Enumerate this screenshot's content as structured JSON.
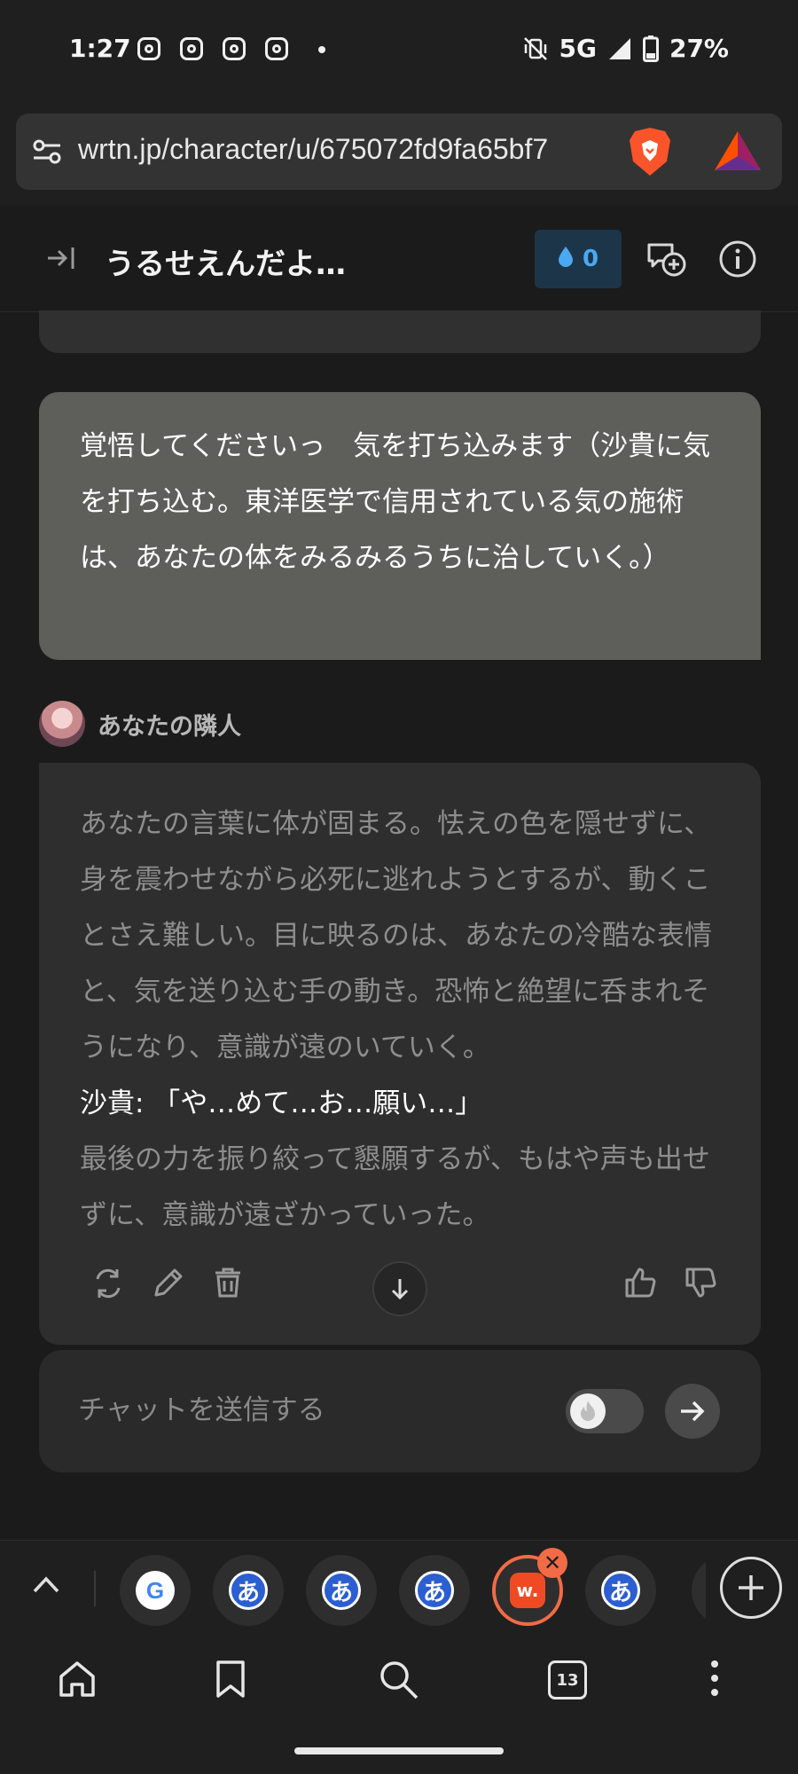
{
  "status_bar": {
    "time": "1:27",
    "notification_icons": [
      "instagram-icon",
      "instagram-icon",
      "instagram-icon",
      "instagram-icon"
    ],
    "network": "5G",
    "battery": "27%"
  },
  "browser": {
    "url": "wrtn.jp/character/u/675072fd9fa65bf7",
    "extension_icons": [
      "brave-shield-icon",
      "brave-rewards-icon"
    ]
  },
  "header": {
    "title": "うるせえんだよ…",
    "drops_count": "0"
  },
  "messages": {
    "user": "覚悟してくださいっ　気を打ち込みます（沙貴に気を打ち込む。東洋医学で信用されている気の施術は、あなたの体をみるみるうちに治していく。）",
    "bot_name": "あなたの隣人",
    "bot_narration_1": "あなたの言葉に体が固まる。怯えの色を隠せずに、身を震わせながら必死に逃れようとするが、動くことさえ難しい。目に映るのは、あなたの冷酷な表情と、気を送り込む手の動き。恐怖と絶望に呑まれそうになり、意識が遠のいていく。",
    "bot_dialogue": "沙貴: 「や…めて…お…願い…」",
    "bot_narration_2": "最後の力を振り絞って懇願するが、もはや声も出せずに、意識が遠ざかっていった。"
  },
  "input": {
    "placeholder": "チャットを送信する"
  },
  "tabs": {
    "items": [
      {
        "icon": "google-icon",
        "glyph": "G"
      },
      {
        "icon": "japanese-translate-icon",
        "glyph": "あ"
      },
      {
        "icon": "japanese-translate-icon",
        "glyph": "あ"
      },
      {
        "icon": "japanese-translate-icon",
        "glyph": "あ"
      },
      {
        "icon": "wrtn-icon",
        "glyph": "w."
      },
      {
        "icon": "japanese-translate-icon",
        "glyph": "あ"
      }
    ],
    "close_glyph": "✕",
    "count": "13"
  },
  "colors": {
    "background": "#1b1b1b",
    "user_bubble": "#5e5e5a",
    "bot_bubble": "#2e2e2e",
    "accent_blue": "#4aa9f0",
    "active_tab": "#f26b46"
  }
}
